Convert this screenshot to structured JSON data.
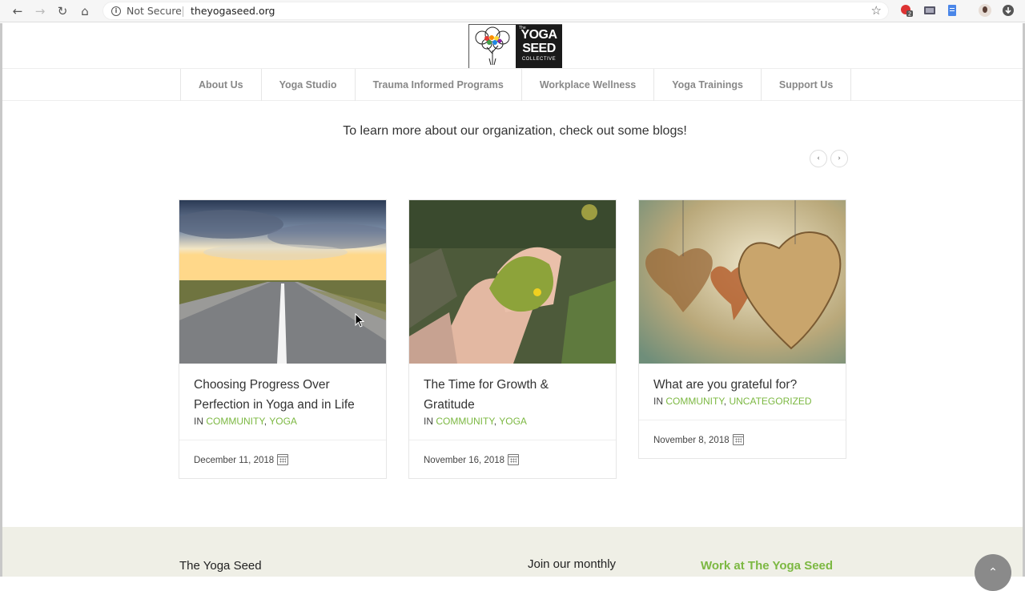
{
  "browser": {
    "security_text": "Not Secure",
    "url": "theyogaseed.org",
    "extension_badge": "2"
  },
  "logo": {
    "the": "The",
    "word1": "YOGA",
    "word2": "SEED",
    "word3": "COLLECTIVE"
  },
  "nav": {
    "items": [
      {
        "label": "About Us"
      },
      {
        "label": "Yoga Studio"
      },
      {
        "label": "Trauma Informed Programs"
      },
      {
        "label": "Workplace Wellness"
      },
      {
        "label": "Yoga Trainings"
      },
      {
        "label": "Support Us"
      }
    ]
  },
  "blogs": {
    "intro": "To learn more about our organization, check out some blogs!",
    "prev_icon": "chevron-left-icon",
    "next_icon": "chevron-right-icon",
    "posts": [
      {
        "title_line1": "Choosing Progress Over",
        "title_line2": "Perfection in Yoga and in Life",
        "in": "IN",
        "cat1": "COMMUNITY",
        "cat2": "YOGA",
        "date": "December 11, 2018"
      },
      {
        "title_line1": "The Time for Growth &",
        "title_line2": "Gratitude",
        "in": "IN",
        "cat1": "COMMUNITY",
        "cat2": "YOGA",
        "date": "November 16, 2018"
      },
      {
        "title_line1": "What are you grateful for?",
        "in": "IN",
        "cat1": "COMMUNITY",
        "cat2": "UNCATEGORIZED",
        "date": "November 8, 2018"
      }
    ]
  },
  "footer": {
    "col1_title": "The Yoga Seed",
    "col2_title": "Join our monthly",
    "col3_title": "Work at The Yoga Seed"
  },
  "colors": {
    "accent_green": "#7cb842",
    "footer_bg": "#efefe6"
  }
}
